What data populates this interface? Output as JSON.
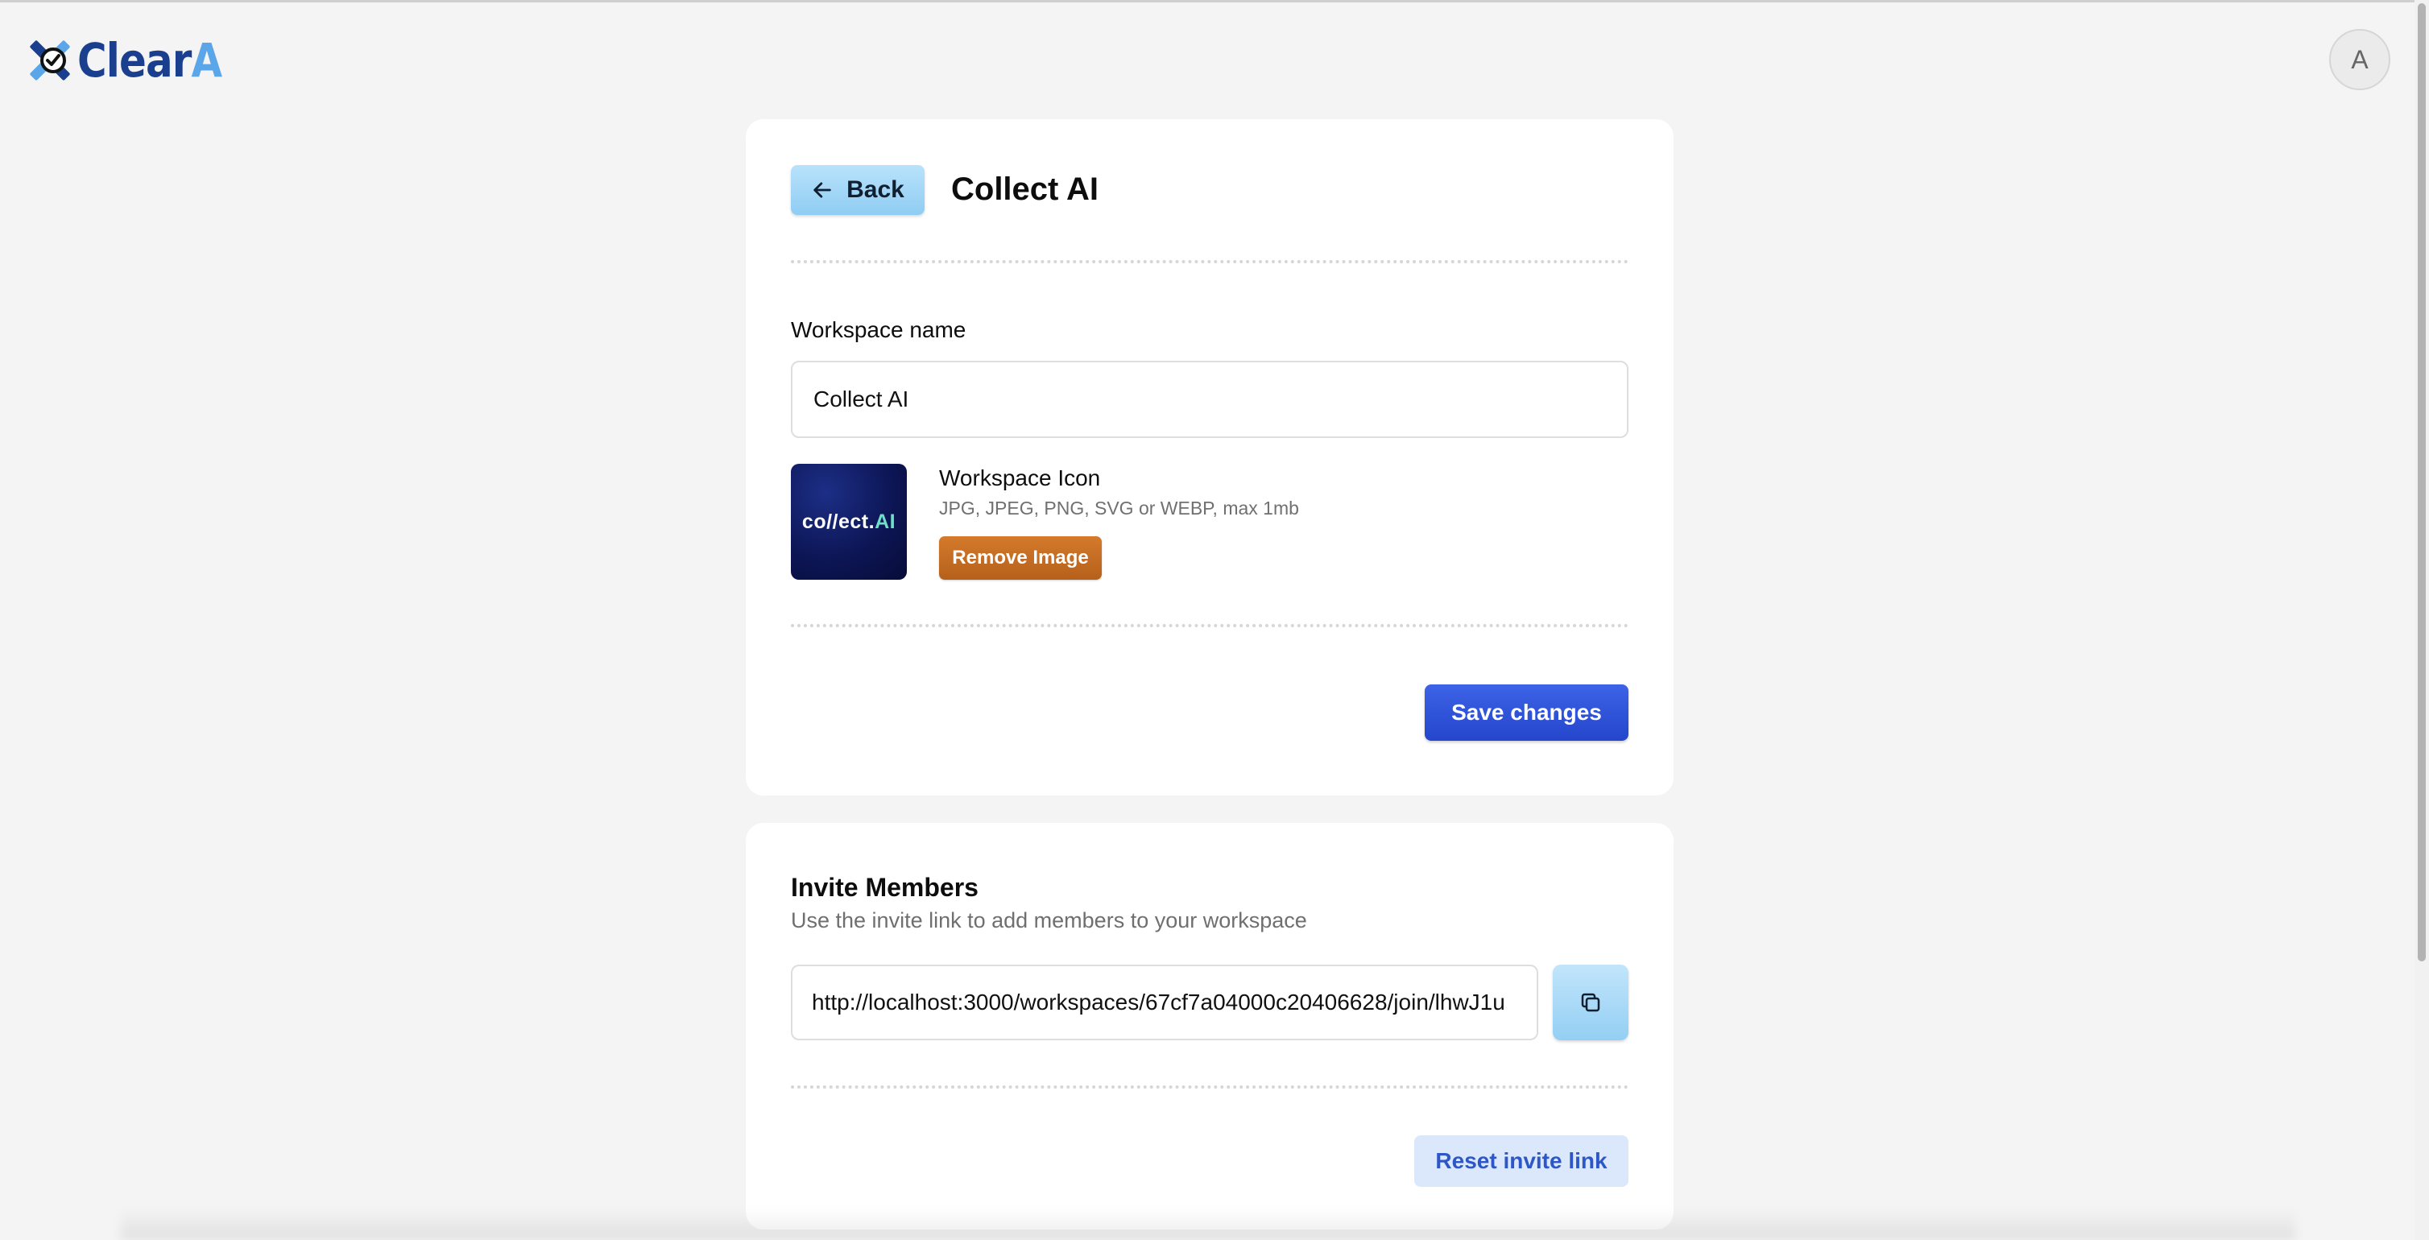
{
  "brand": {
    "name_main": "Clear",
    "name_accent": "A",
    "logo_icon": "clear-logo-icon",
    "primary_color": "#1a3f8f",
    "accent_color": "#5aa6e8"
  },
  "user": {
    "avatar_initial": "A"
  },
  "header": {
    "back_label": "Back",
    "title": "Collect AI"
  },
  "workspace_form": {
    "name_label": "Workspace name",
    "name_value": "Collect AI",
    "icon_title": "Workspace Icon",
    "icon_hint": "JPG, JPEG, PNG, SVG or WEBP, max 1mb",
    "icon_image_text_main": "co//ect.",
    "icon_image_text_accent": "AI",
    "remove_image_label": "Remove Image",
    "save_label": "Save changes"
  },
  "invite": {
    "title": "Invite Members",
    "subtitle": "Use the invite link to add members to your workspace",
    "link": "http://localhost:3000/workspaces/67cf7a04000c20406628/join/lhwJ1u",
    "copy_icon": "copy-icon",
    "reset_label": "Reset invite link"
  },
  "colors": {
    "back_button": "#a9daf8",
    "remove_button": "#c46a24",
    "save_button": "#2f55d9",
    "reset_button_bg": "#dbe8fb",
    "reset_button_text": "#2d56c7"
  }
}
